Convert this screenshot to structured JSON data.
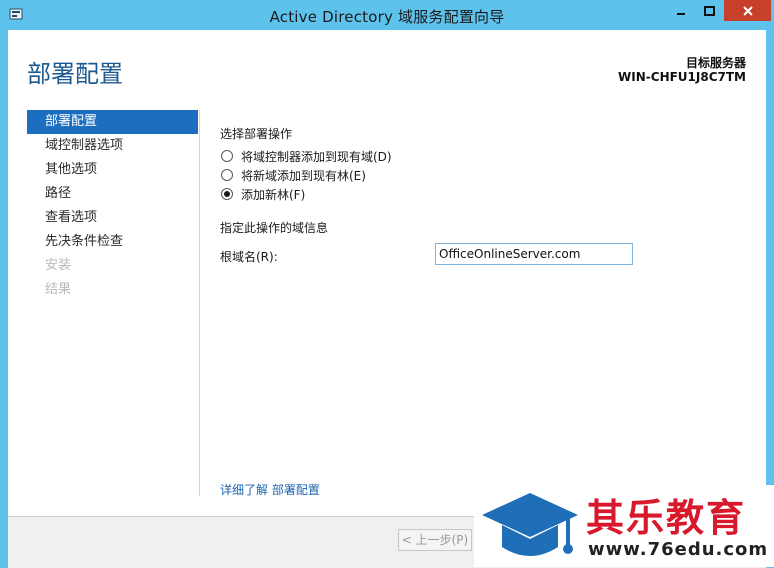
{
  "window": {
    "title": "Active Directory 域服务配置向导"
  },
  "header": {
    "page_title": "部署配置",
    "target_label": "目标服务器",
    "target_server": "WIN-CHFU1J8C7TM"
  },
  "sidebar": {
    "items": [
      {
        "label": "部署配置",
        "state": "active"
      },
      {
        "label": "域控制器选项",
        "state": "enabled"
      },
      {
        "label": "其他选项",
        "state": "enabled"
      },
      {
        "label": "路径",
        "state": "enabled"
      },
      {
        "label": "查看选项",
        "state": "enabled"
      },
      {
        "label": "先决条件检查",
        "state": "enabled"
      },
      {
        "label": "安装",
        "state": "disabled"
      },
      {
        "label": "结果",
        "state": "disabled"
      }
    ]
  },
  "main": {
    "operation_heading": "选择部署操作",
    "options": [
      {
        "label": "将域控制器添加到现有域(D)",
        "checked": false
      },
      {
        "label": "将新域添加到现有林(E)",
        "checked": false
      },
      {
        "label": "添加新林(F)",
        "checked": true
      }
    ],
    "domain_info_heading": "指定此操作的域信息",
    "root_domain_label": "根域名(R):",
    "root_domain_value": "OfficeOnlineServer.com",
    "learn_more_link": "详细了解 部署配置"
  },
  "footer": {
    "prev_label": "< 上一步(P)"
  },
  "watermark": {
    "name": "其乐教育",
    "url": "www.76edu.com"
  },
  "colors": {
    "titlebar": "#5ec3ec",
    "close_button": "#c7402c",
    "accent": "#1c6fc0",
    "page_title": "#1e5a92",
    "watermark_red": "#d7192b",
    "watermark_blue": "#1e6fb8"
  }
}
